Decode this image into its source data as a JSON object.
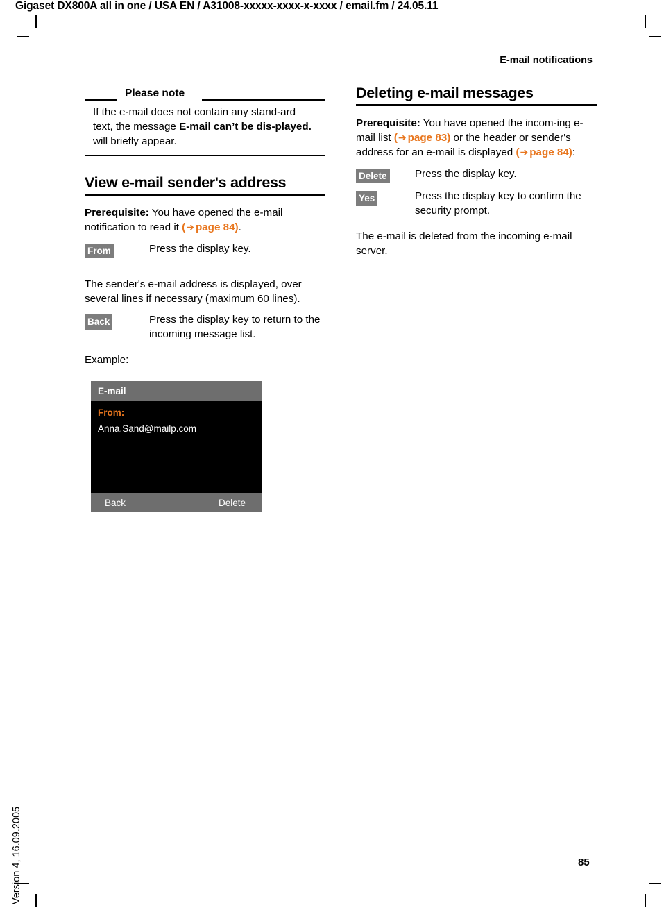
{
  "header": {
    "doc_path": "Gigaset DX800A all in one / USA EN / A31008-xxxxx-xxxx-x-xxxx / email.fm / 24.05.11",
    "chapter": "E-mail notifications"
  },
  "footer": {
    "page_number": "85",
    "version_stamp": "Version 4, 16.09.2005"
  },
  "note": {
    "title": "Please note",
    "text_part1": "If the e-mail does not contain any stand-ard text, the message ",
    "bold_phrase": "E-mail can’t be dis-played.",
    "text_part2": " will briefly appear."
  },
  "left_column": {
    "section_title": "View e-mail sender's address",
    "prereq_label": "Prerequisite:",
    "prereq_text": " You have opened the e-mail notification to read it ",
    "prereq_ref_open": "(",
    "prereq_ref_arrow": "➔",
    "prereq_ref_label": "page 84)",
    "prereq_ref_tail": ".",
    "key_from": {
      "badge": "From",
      "description": "Press the display key."
    },
    "paragraph_sender": "The sender's e-mail address is displayed, over several lines if necessary (maximum 60 lines).",
    "key_back": {
      "badge": "Back",
      "description": "Press the display key to return to the incoming message list."
    },
    "example_label": "Example:"
  },
  "display": {
    "title": "E-mail",
    "from_label": "From:",
    "from_value": "Anna.Sand@mailp.com",
    "softkey_left": "Back",
    "softkey_right": "Delete",
    "colors": {
      "bar": "#6e6e6e",
      "screen": "#000000",
      "accent": "#E8761E",
      "text": "#ffffff"
    }
  },
  "right_column": {
    "section_title": "Deleting e-mail messages",
    "prereq_label": "Prerequisite:",
    "prereq_text_1": " You have opened the incom-ing e-mail list ",
    "ref1_open": "(",
    "ref1_arrow": "➔",
    "ref1_label": "page 83)",
    "prereq_text_2": " or the header or sender's address for an e-mail is displayed ",
    "ref2_open": "(",
    "ref2_arrow": "➔",
    "ref2_label": "page 84)",
    "prereq_text_3": ":",
    "key_delete": {
      "badge": "Delete",
      "description": "Press the display key."
    },
    "key_yes": {
      "badge": "Yes",
      "description": "Press the display key to confirm the security prompt."
    },
    "result_text": "The e-mail is deleted from the incoming e-mail server."
  },
  "theme": {
    "accent_orange": "#E8761E",
    "badge_gray": "#7d7d7d",
    "bar_gray": "#6e6e6e"
  }
}
